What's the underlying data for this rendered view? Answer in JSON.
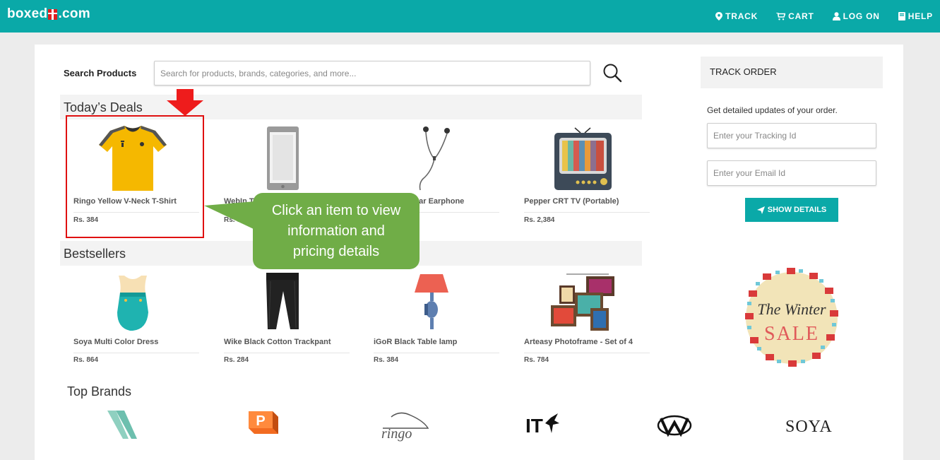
{
  "header": {
    "logo_left": "boxed",
    "logo_right": ".com",
    "nav": [
      {
        "label": "TRACK",
        "icon": "map-marker-icon"
      },
      {
        "label": "CART",
        "icon": "cart-icon"
      },
      {
        "label": "LOG ON",
        "icon": "user-icon"
      },
      {
        "label": "HELP",
        "icon": "book-icon"
      }
    ]
  },
  "search": {
    "label": "Search Products",
    "placeholder": "Search for products, brands, categories, and more...",
    "value": ""
  },
  "deals": {
    "title": "Today’s Deals",
    "products": [
      {
        "name": "Ringo Yellow V-Neck T-Shirt",
        "price": "Rs. 384",
        "image": "yellow-tshirt-image"
      },
      {
        "name": "WebIn T",
        "price": "Rs. 3",
        "image": "phone-image"
      },
      {
        "name": "ear Earphone",
        "price": "",
        "image": "earphone-image"
      },
      {
        "name": "Pepper CRT TV (Portable)",
        "price": "Rs. 2,384",
        "image": "crt-tv-image"
      }
    ]
  },
  "bestsellers": {
    "title": "Bestsellers",
    "products": [
      {
        "name": "Soya Multi Color Dress",
        "price": "Rs. 864",
        "image": "dress-image"
      },
      {
        "name": "Wike Black Cotton Trackpant",
        "price": "Rs. 284",
        "image": "trackpant-image"
      },
      {
        "name": "iGoR Black Table lamp",
        "price": "Rs. 384",
        "image": "table-lamp-image"
      },
      {
        "name": "Arteasy Photoframe - Set of 4",
        "price": "Rs. 784",
        "image": "photoframe-image"
      }
    ]
  },
  "callout": {
    "lines": [
      "Click an item to view",
      "information and",
      "pricing details"
    ],
    "color": "#70ad47"
  },
  "track_order": {
    "title": "TRACK ORDER",
    "description": "Get detailed updates of your order.",
    "tracking_placeholder": "Enter your Tracking Id",
    "email_placeholder": "Enter your Email Id",
    "button_label": "SHOW DETAILS"
  },
  "sale_badge": {
    "line1": "The Winter",
    "line2": "SALE"
  },
  "brands": {
    "title": "Top Brands",
    "items": [
      "wike-logo",
      "pepper-logo",
      "ringo-logo",
      "itk-logo",
      "webin-logo",
      "soya-logo"
    ],
    "ringo_text": "ringo",
    "itk_text": "IT",
    "soya_text": "SOYA"
  },
  "colors": {
    "brand_teal": "#0aa9a8",
    "highlight_red": "#e01010"
  }
}
